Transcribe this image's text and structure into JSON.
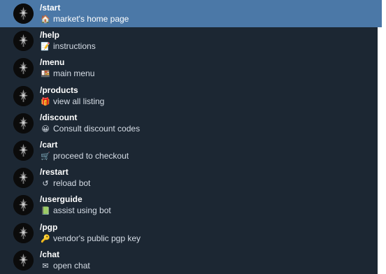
{
  "commands": [
    {
      "command": "/start",
      "icon": "house-icon",
      "emoji": "🏠",
      "description": "market's home page",
      "selected": true
    },
    {
      "command": "/help",
      "icon": "memo-icon",
      "emoji": "📝",
      "description": "instructions",
      "selected": false
    },
    {
      "command": "/menu",
      "icon": "bento-box-icon",
      "emoji": "🍱",
      "description": "main menu",
      "selected": false
    },
    {
      "command": "/products",
      "icon": "gift-icon",
      "emoji": "🎁",
      "description": "view all listing",
      "selected": false
    },
    {
      "command": "/discount",
      "icon": "smiley-icon",
      "emoji": "😀",
      "description": "Consult discount codes",
      "selected": false
    },
    {
      "command": "/cart",
      "icon": "cart-icon",
      "emoji": "🛒",
      "description": "proceed to checkout",
      "selected": false
    },
    {
      "command": "/restart",
      "icon": "reload-icon",
      "emoji": "↺",
      "description": "reload bot",
      "selected": false
    },
    {
      "command": "/userguide",
      "icon": "book-icon",
      "emoji": "📗",
      "description": "assist using bot",
      "selected": false
    },
    {
      "command": "/pgp",
      "icon": "key-icon",
      "emoji": "🔑",
      "description": "vendor's public pgp key",
      "selected": false
    },
    {
      "command": "/chat",
      "icon": "envelope-icon",
      "emoji": "✉",
      "description": "open chat",
      "selected": false
    }
  ],
  "colors": {
    "panel_background": "#1c2733",
    "selected_row": "#4b78a7",
    "command_text": "#ffffff",
    "description_text": "#d6dde6"
  }
}
